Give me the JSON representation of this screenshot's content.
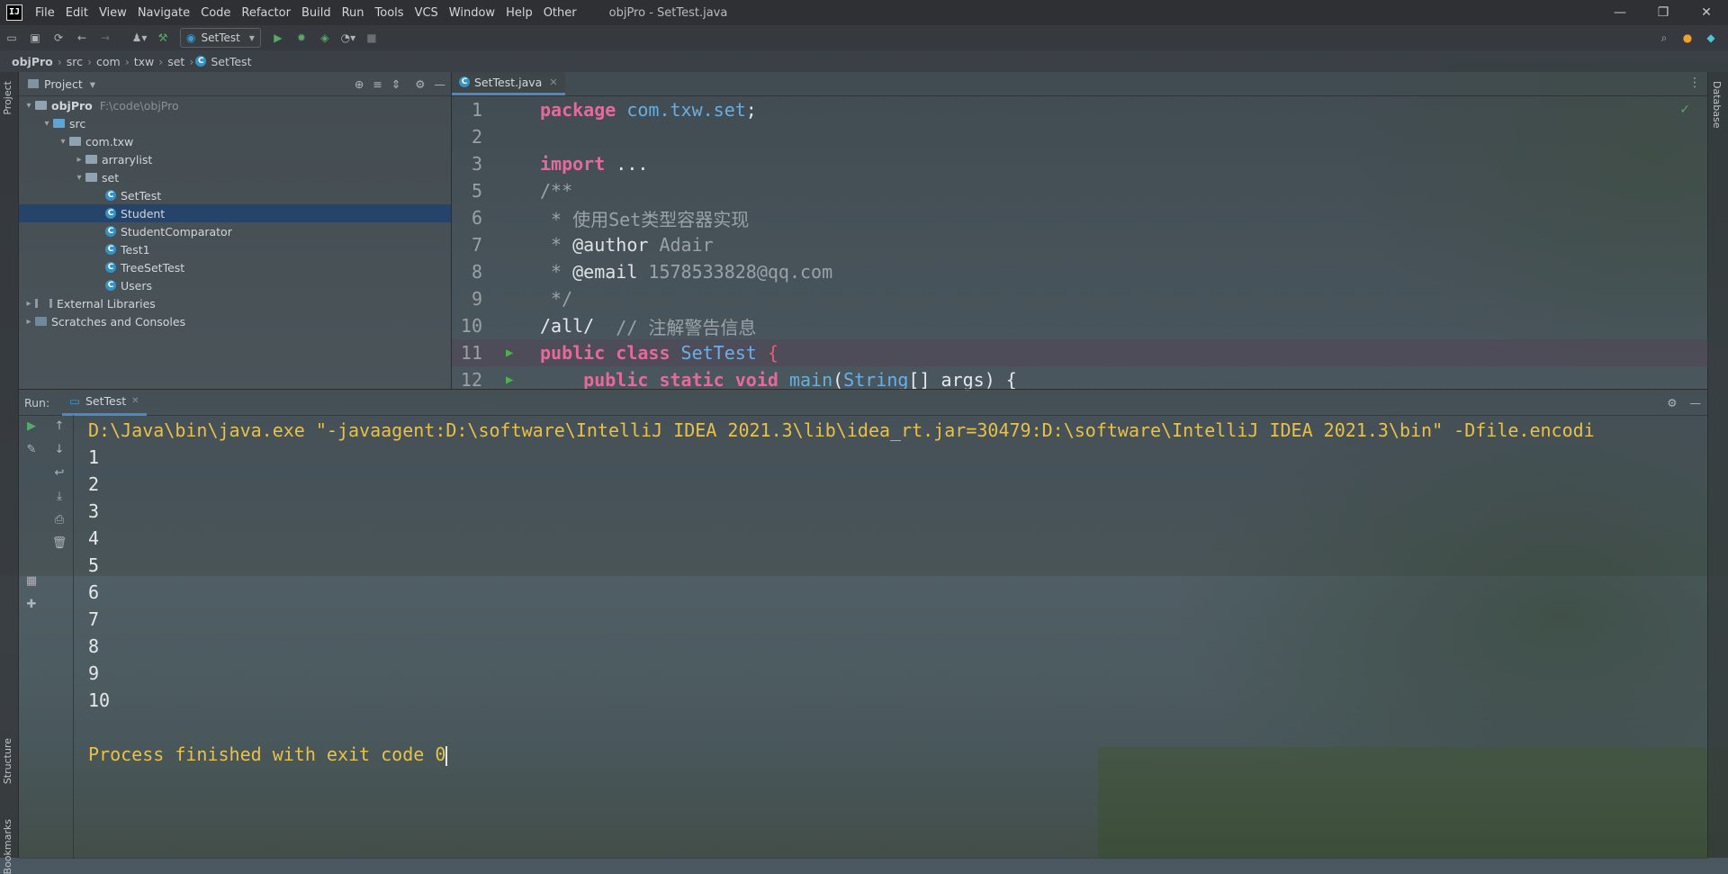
{
  "window": {
    "title": "objPro - SetTest.java",
    "logo_text": "IJ",
    "controls": [
      "—",
      "❐",
      "✕"
    ]
  },
  "menu": [
    "File",
    "Edit",
    "View",
    "Navigate",
    "Code",
    "Refactor",
    "Build",
    "Run",
    "Tools",
    "VCS",
    "Window",
    "Help",
    "Other"
  ],
  "toolbar": {
    "run_config": "SetTest"
  },
  "breadcrumb": [
    "objPro",
    "src",
    "com",
    "txw",
    "set",
    "SetTest"
  ],
  "side_tabs": {
    "project": "Project",
    "structure": "Structure",
    "bookmarks": "Bookmarks",
    "database": "Database"
  },
  "project": {
    "header": "Project",
    "root_name": "objPro",
    "root_path": "F:\\code\\objPro",
    "src": "src",
    "package": "com.txw",
    "arrarylist": "arrarylist",
    "set": "set",
    "classes": [
      "SetTest",
      "Student",
      "StudentComparator",
      "Test1",
      "TreeSetTest",
      "Users"
    ],
    "selected": "Student",
    "external_libraries": "External Libraries",
    "scratches": "Scratches and Consoles"
  },
  "editor": {
    "tab": "SetTest.java",
    "lines": [
      {
        "n": "1",
        "parts": [
          [
            "kw",
            "package "
          ],
          [
            "pk",
            "com.txw.set"
          ],
          [
            "plain",
            ";"
          ]
        ]
      },
      {
        "n": "2",
        "parts": []
      },
      {
        "n": "3",
        "parts": [
          [
            "kw",
            "import "
          ],
          [
            "plain",
            "..."
          ]
        ]
      },
      {
        "n": "5",
        "parts": [
          [
            "cm",
            "/**"
          ]
        ]
      },
      {
        "n": "6",
        "parts": [
          [
            "cm",
            " * 使用Set类型容器实现"
          ]
        ]
      },
      {
        "n": "7",
        "parts": [
          [
            "cm",
            " * "
          ],
          [
            "tag",
            "@author"
          ],
          [
            "cm",
            " Adair"
          ]
        ]
      },
      {
        "n": "8",
        "parts": [
          [
            "cm",
            " * "
          ],
          [
            "tag",
            "@email"
          ],
          [
            "cm",
            " 1578533828@qq.com"
          ]
        ]
      },
      {
        "n": "9",
        "parts": [
          [
            "cm",
            " */"
          ]
        ]
      },
      {
        "n": "10",
        "parts": [
          [
            "plain",
            "/all/  "
          ],
          [
            "cm",
            "// 注解警告信息"
          ]
        ]
      },
      {
        "n": "11",
        "run": true,
        "hl": true,
        "parts": [
          [
            "kw",
            "public class "
          ],
          [
            "cls",
            "SetTest "
          ],
          [
            "brace",
            "{"
          ]
        ]
      },
      {
        "n": "12",
        "run": true,
        "parts": [
          [
            "plain",
            "    "
          ],
          [
            "kw",
            "public static void "
          ],
          [
            "fn",
            "main"
          ],
          [
            "plain",
            "("
          ],
          [
            "cls",
            "String"
          ],
          [
            "plain",
            "[] args) {"
          ]
        ]
      }
    ]
  },
  "run": {
    "label": "Run:",
    "tab": "SetTest",
    "command": "D:\\Java\\bin\\java.exe \"-javaagent:D:\\software\\IntelliJ IDEA 2021.3\\lib\\idea_rt.jar=30479:D:\\software\\IntelliJ IDEA 2021.3\\bin\" -Dfile.encodi",
    "output": [
      "1",
      "2",
      "3",
      "4",
      "5",
      "6",
      "7",
      "8",
      "9",
      "10",
      ""
    ],
    "exit": "Process finished with exit code 0"
  }
}
